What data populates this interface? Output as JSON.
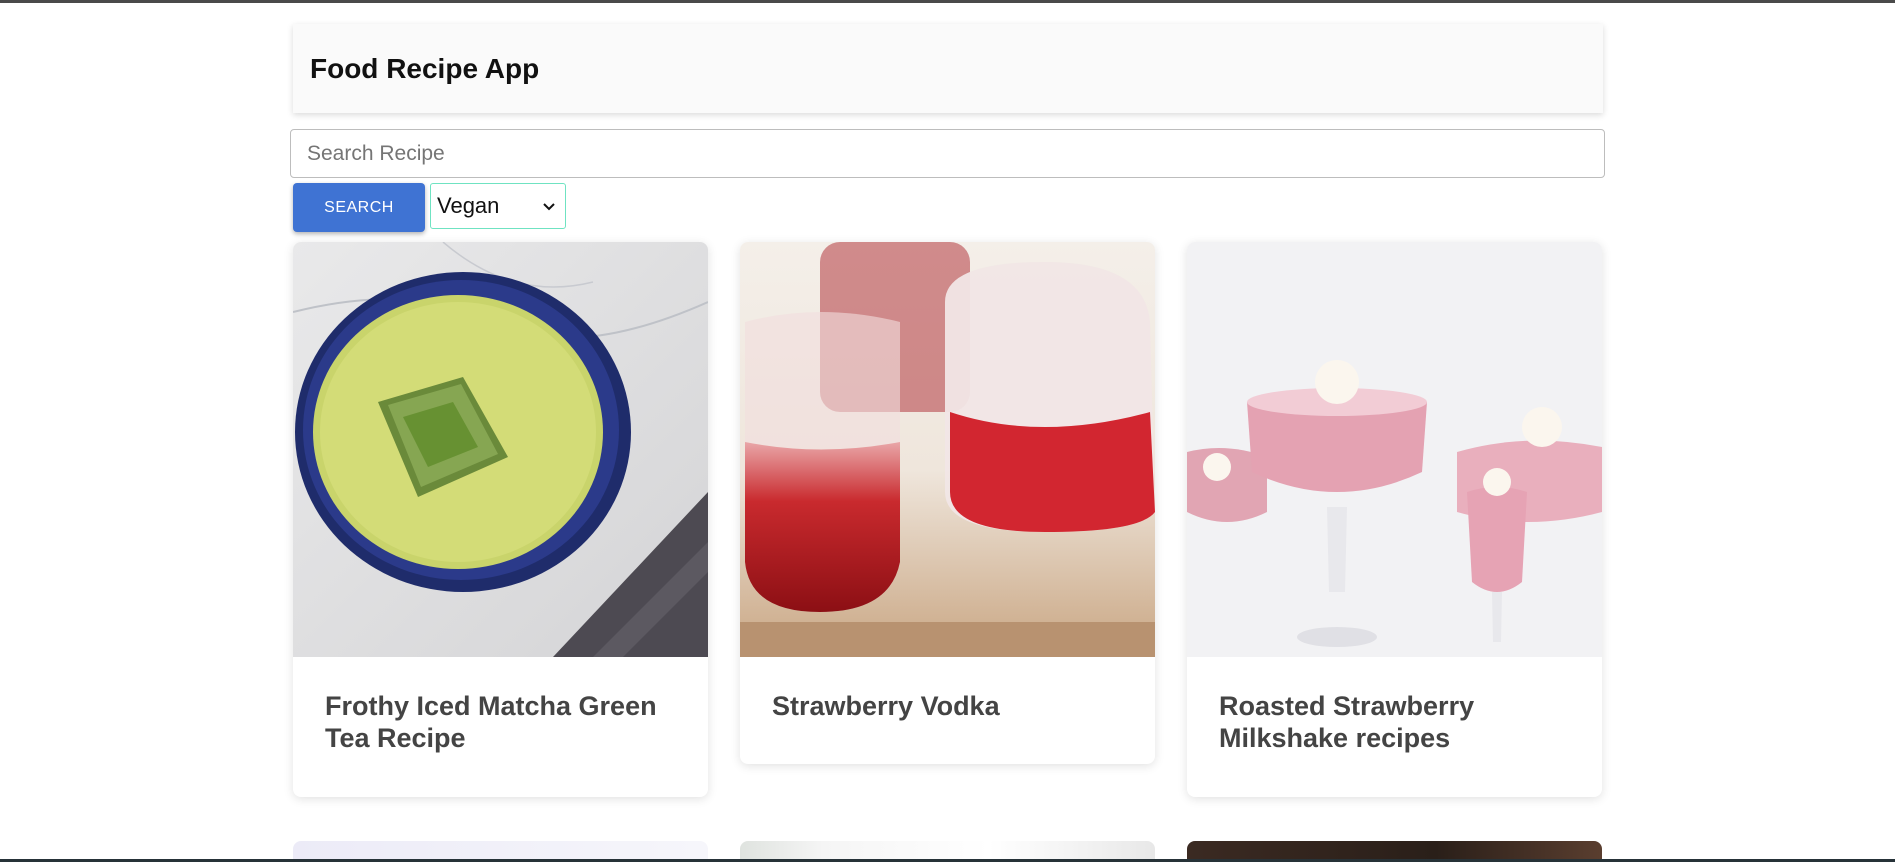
{
  "header": {
    "title": "Food Recipe App"
  },
  "search": {
    "placeholder": "Search Recipe",
    "value": "",
    "button_label": "SEARCH"
  },
  "filter": {
    "selected": "Vegan",
    "icon": "chevron-down-icon"
  },
  "recipes": [
    {
      "title": "Frothy Iced Matcha Green Tea Recipe"
    },
    {
      "title": "Strawberry Vodka"
    },
    {
      "title": "Roasted Strawberry Milkshake recipes"
    }
  ],
  "colors": {
    "accent": "#3f73d3",
    "select_border": "#6fe3c2",
    "header_bg": "#fafafa",
    "card_title": "#444444"
  }
}
